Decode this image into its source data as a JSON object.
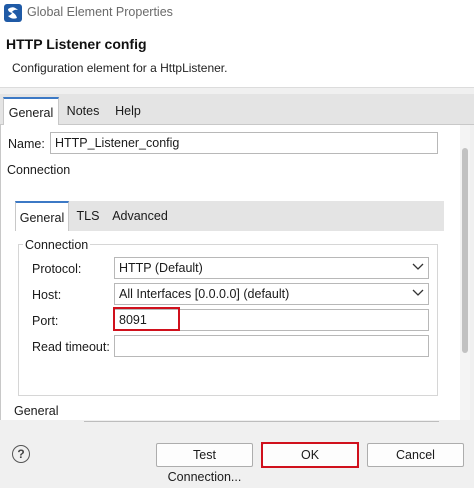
{
  "window": {
    "title": "Global Element Properties",
    "heading": "HTTP Listener config",
    "description": "Configuration element for a HttpListener."
  },
  "tabs": [
    "General",
    "Notes",
    "Help"
  ],
  "name_field": {
    "label": "Name:",
    "value": "HTTP_Listener_config"
  },
  "connection_section": "Connection",
  "inner_tabs": [
    "General",
    "TLS",
    "Advanced"
  ],
  "connection_group": {
    "legend": "Connection",
    "protocol": {
      "label": "Protocol:",
      "value": "HTTP (Default)"
    },
    "host": {
      "label": "Host:",
      "value": "All Interfaces [0.0.0.0] (default)"
    },
    "port": {
      "label": "Port:",
      "value": "8091"
    },
    "read_timeout": {
      "label": "Read timeout:",
      "value": ""
    }
  },
  "general_section": "General",
  "buttons": {
    "help": "?",
    "test": "Test Connection...",
    "ok": "OK",
    "cancel": "Cancel"
  },
  "colors": {
    "accent": "#3c79c5",
    "highlight": "#d0101c",
    "brand_icon": "#1f5aa6"
  },
  "icons": {
    "app": "app-logo-icon",
    "dropdown": "chevron-down-icon",
    "help": "help-circle-icon"
  }
}
